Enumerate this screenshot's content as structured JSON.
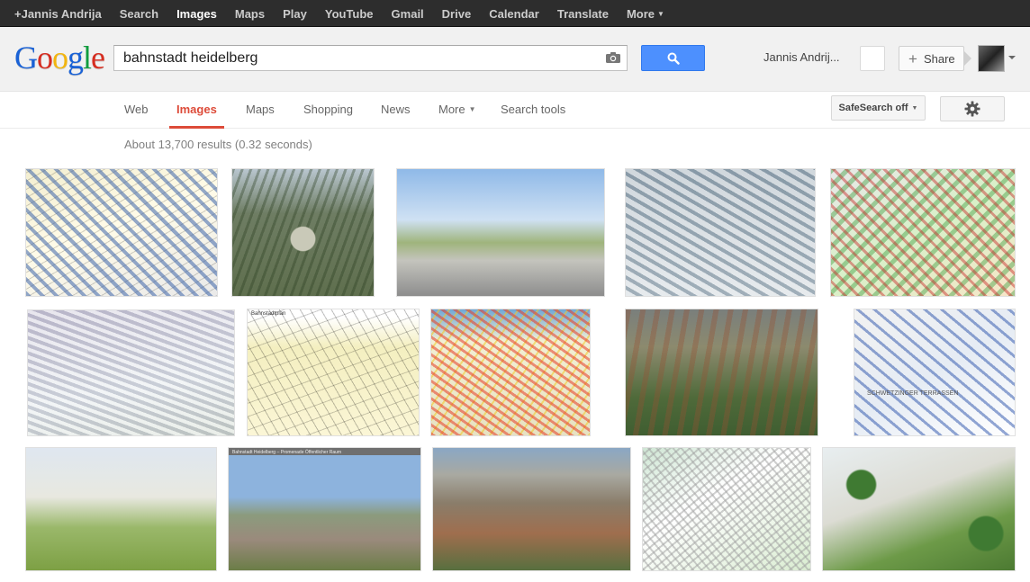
{
  "topbar": {
    "links": [
      "+Jannis Andrija",
      "Search",
      "Images",
      "Maps",
      "Play",
      "YouTube",
      "Gmail",
      "Drive",
      "Calendar",
      "Translate",
      "More"
    ],
    "active": "Images"
  },
  "header": {
    "logo": "Google",
    "query": "bahnstadt heidelberg",
    "user_name": "Jannis Andrij...",
    "share_label": "Share"
  },
  "nav": {
    "tabs": [
      "Web",
      "Images",
      "Maps",
      "Shopping",
      "News",
      "More",
      "Search tools"
    ],
    "active": "Images",
    "safesearch_label": "SafeSearch off"
  },
  "results": {
    "stats": "About 13,700 results (0.32 seconds)"
  },
  "thumb_labels": {
    "plan": "Bahnstadtplan",
    "promenade": "Bahnstadt Heidelberg – Promenade Öffentlicher Raum",
    "bluemap_text": "SCHWETZINGER TERRASSEN"
  },
  "colors": {
    "topbar_bg": "#2d2d2d",
    "accent_red": "#dd4b39",
    "search_blue": "#4d90fe"
  },
  "icons": {
    "camera": "camera-icon",
    "search": "magnifier-icon",
    "settings": "gear-icon"
  }
}
